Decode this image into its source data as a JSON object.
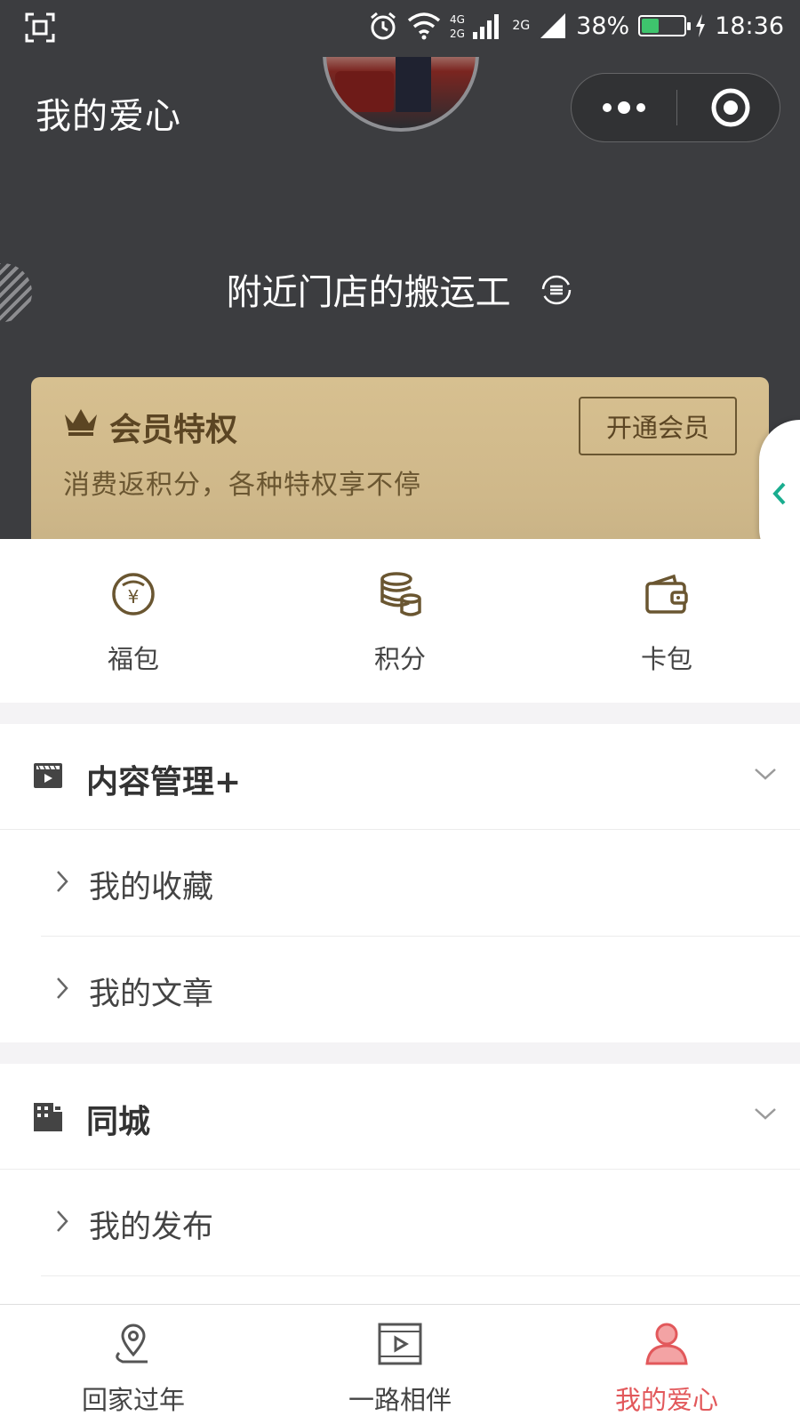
{
  "status_bar": {
    "battery": "38%",
    "time": "18:36",
    "net_label": "2G"
  },
  "header": {
    "title": "我的爱心",
    "username": "附近门店的搬运工"
  },
  "vip": {
    "title": "会员特权",
    "subtitle": "消费返积分，各种特权享不停",
    "button": "开通会员"
  },
  "quick": [
    {
      "label": "福包",
      "icon": "lucky-bag-icon"
    },
    {
      "label": "积分",
      "icon": "points-coins-icon"
    },
    {
      "label": "卡包",
      "icon": "wallet-icon"
    }
  ],
  "sections": [
    {
      "title": "内容管理+",
      "icon": "content-management-icon",
      "items": [
        "我的收藏",
        "我的文章"
      ]
    },
    {
      "title": "同城",
      "icon": "city-icon",
      "items": [
        "我的发布"
      ]
    }
  ],
  "tabs": [
    {
      "label": "回家过年",
      "icon": "location-pin-icon",
      "active": false
    },
    {
      "label": "一路相伴",
      "icon": "video-play-icon",
      "active": false
    },
    {
      "label": "我的爱心",
      "icon": "user-profile-icon",
      "active": true
    }
  ],
  "colors": {
    "header_bg": "#3c3d40",
    "vip_gold": "#d2bb8c",
    "active_tab": "#e2585b",
    "battery_green": "#3ec46d"
  }
}
